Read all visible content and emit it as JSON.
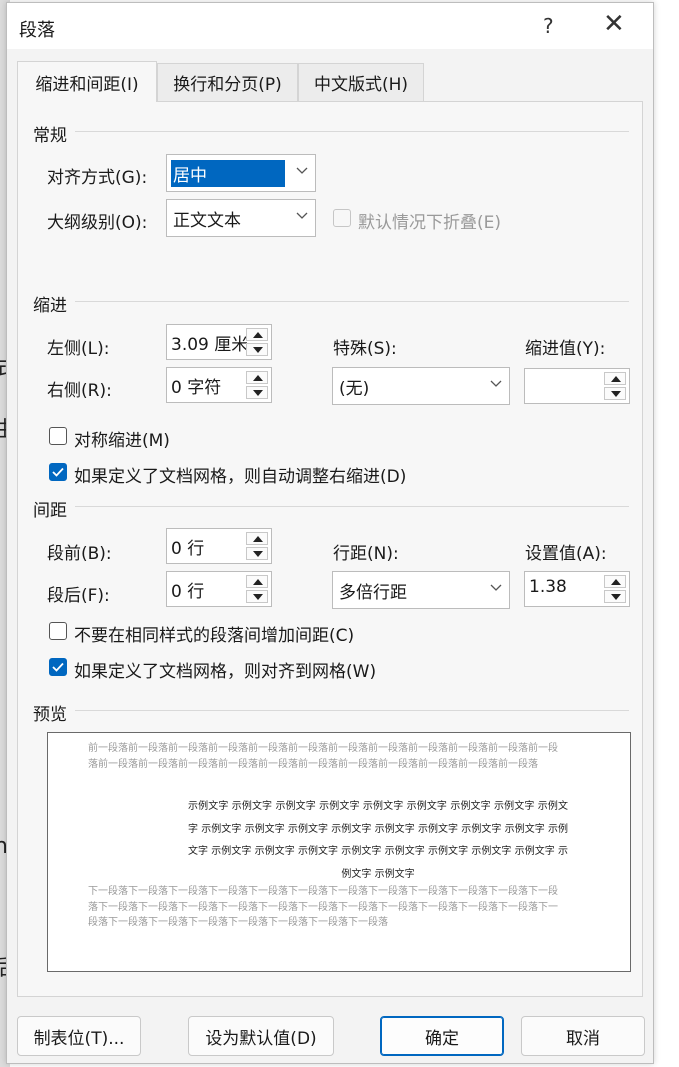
{
  "dialog": {
    "title": "段落",
    "help_glyph": "?",
    "close_glyph": "✕"
  },
  "tabs": [
    {
      "label": "缩进和间距(I)",
      "active": true
    },
    {
      "label": "换行和分页(P)",
      "active": false
    },
    {
      "label": "中文版式(H)",
      "active": false
    }
  ],
  "general": {
    "heading": "常规",
    "alignment_label": "对齐方式(G):",
    "alignment_value": "居中",
    "outline_label": "大纲级别(O):",
    "outline_value": "正文文本",
    "collapse_label": "默认情况下折叠(E)"
  },
  "indent": {
    "heading": "缩进",
    "left_label": "左侧(L):",
    "left_value": "3.09 厘米",
    "right_label": "右侧(R):",
    "right_value": "0 字符",
    "special_label": "特殊(S):",
    "special_value": "(无)",
    "by_label": "缩进值(Y):",
    "by_value": "",
    "mirror_label": "对称缩进(M)",
    "mirror_checked": false,
    "auto_adjust_label": "如果定义了文档网格，则自动调整右缩进(D)",
    "auto_adjust_checked": true
  },
  "spacing": {
    "heading": "间距",
    "before_label": "段前(B):",
    "before_value": "0 行",
    "after_label": "段后(F):",
    "after_value": "0 行",
    "line_label": "行距(N):",
    "line_value": "多倍行距",
    "at_label": "设置值(A):",
    "at_value": "1.38",
    "no_space_label": "不要在相同样式的段落间增加间距(C)",
    "no_space_checked": false,
    "snap_label": "如果定义了文档网格，则对齐到网格(W)",
    "snap_checked": true
  },
  "preview": {
    "heading": "预览",
    "before_text": "前一段落前一段落前一段落前一段落前一段落前一段落前一段落前一段落前一段落前一段落前一段落前一段落前一段落前一段落前一段落前一段落前一段落前一段落前一段落前一段落前一段落前一段落前一段落",
    "sample_text": "示例文字 示例文字 示例文字 示例文字 示例文字 示例文字 示例文字 示例文字 示例文字 示例文字 示例文字 示例文字 示例文字 示例文字 示例文字 示例文字 示例文字 示例文字 示例文字 示例文字 示例文字 示例文字 示例文字 示例文字 示例文字 示例文字 示例文字 示例文字",
    "after_text": "下一段落下一段落下一段落下一段落下一段落下一段落下一段落下一段落下一段落下一段落下一段落下一段落下一段落下一段落下一段落下一段落下一段落下一段落下一段落下一段落下一段落下一段落下一段落下一段落下一段落下一段落下一段落下一段落下一段落下一段落下一段落"
  },
  "buttons": {
    "tabs": "制表位(T)...",
    "default": "设为默认值(D)",
    "ok": "确定",
    "cancel": "取消"
  },
  "background_glyphs": [
    "式",
    "由",
    "n",
    "l",
    "后"
  ],
  "colors": {
    "accent": "#0067c0"
  }
}
